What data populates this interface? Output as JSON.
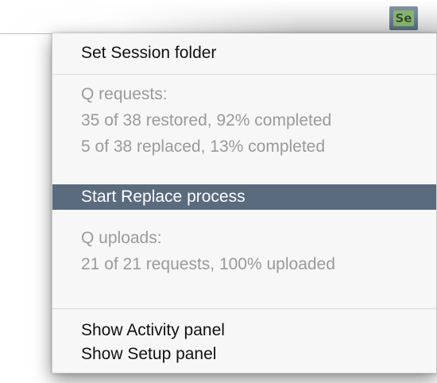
{
  "menubar": {
    "status_item_label": "Se"
  },
  "menu": {
    "set_session_folder": "Set Session folder",
    "q_requests_header": "Q requests:",
    "q_requests_restored": "35 of 38 restored, 92% completed",
    "q_requests_replaced": "5 of 38 replaced, 13% completed",
    "start_replace_process": "Start Replace process",
    "q_uploads_header": "Q uploads:",
    "q_uploads_status": "21 of 21 requests, 100% uploaded",
    "show_activity_panel": "Show Activity panel",
    "show_setup_panel": "Show Setup panel"
  },
  "colors": {
    "highlight": "#5b6b7e",
    "disabled_text": "#9a9a9a",
    "status_icon_green": "#86b36a"
  }
}
